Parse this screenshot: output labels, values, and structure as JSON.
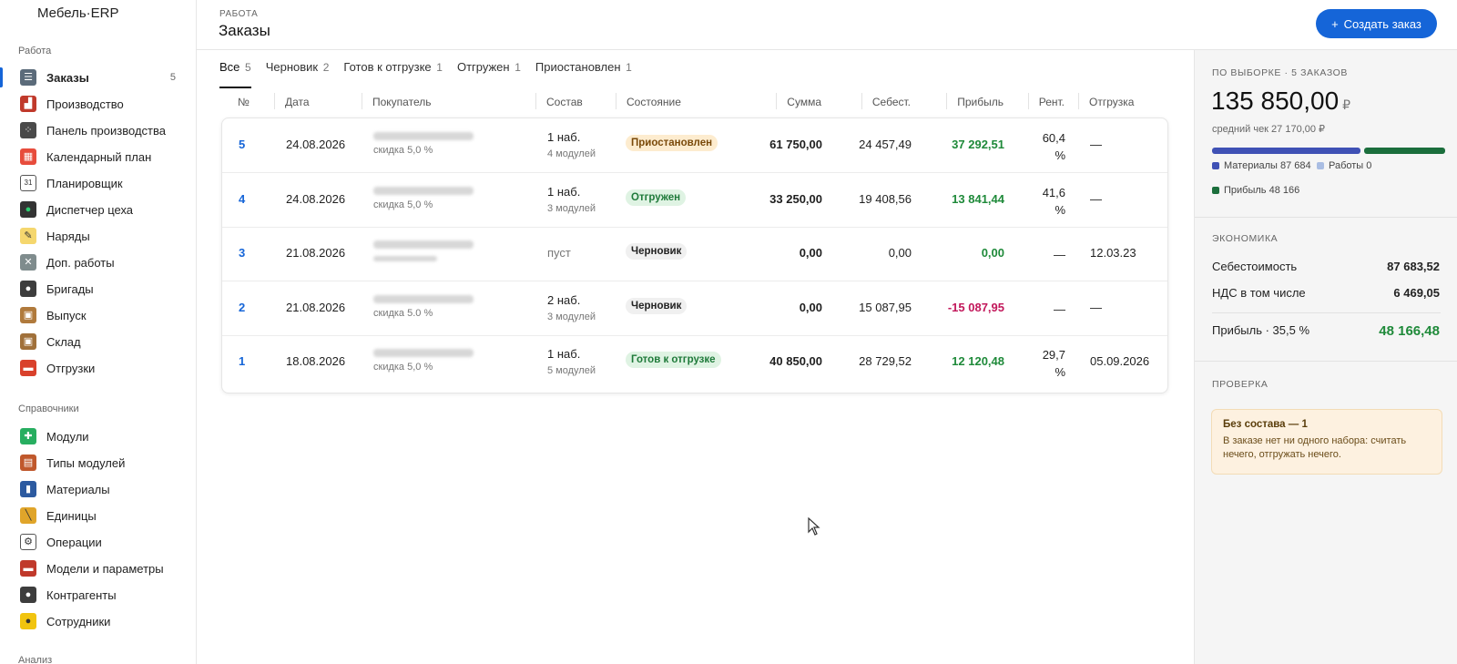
{
  "app": {
    "title": "Мебель·ERP"
  },
  "sidebar": {
    "section_work": "Работа",
    "items_work": [
      {
        "label": "Заказы",
        "icon": "clipboard-icon",
        "count": "5",
        "active": true
      },
      {
        "label": "Производство",
        "icon": "factory-icon"
      },
      {
        "label": "Панель производства",
        "icon": "dice-panel-icon"
      },
      {
        "label": "Календарный план",
        "icon": "calendar-icon"
      },
      {
        "label": "Планировщик",
        "icon": "calendar-31-icon"
      },
      {
        "label": "Диспетчер цеха",
        "icon": "traffic-light-icon"
      },
      {
        "label": "Наряды",
        "icon": "memo-icon"
      },
      {
        "label": "Доп. работы",
        "icon": "tools-icon"
      },
      {
        "label": "Бригады",
        "icon": "team-icon"
      },
      {
        "label": "Выпуск",
        "icon": "box-icon"
      },
      {
        "label": "Склад",
        "icon": "package-icon"
      },
      {
        "label": "Отгрузки",
        "icon": "truck-icon"
      }
    ],
    "section_refs": "Справочники",
    "items_refs": [
      {
        "label": "Модули",
        "icon": "puzzle-icon"
      },
      {
        "label": "Типы модулей",
        "icon": "bricks-icon"
      },
      {
        "label": "Материалы",
        "icon": "thread-icon"
      },
      {
        "label": "Единицы",
        "icon": "ruler-icon"
      },
      {
        "label": "Операции",
        "icon": "gear-icon"
      },
      {
        "label": "Модели и параметры",
        "icon": "car-icon"
      },
      {
        "label": "Контрагенты",
        "icon": "people-icon"
      },
      {
        "label": "Сотрудники",
        "icon": "worker-icon"
      }
    ],
    "section_analysis": "Анализ"
  },
  "header": {
    "breadcrumb": "РАБОТА",
    "title": "Заказы",
    "create_label": "Создать заказ",
    "create_icon": "plus-icon"
  },
  "tabs": [
    {
      "label": "Все",
      "count": "5",
      "active": true
    },
    {
      "label": "Черновик",
      "count": "2"
    },
    {
      "label": "Готов к отгрузке",
      "count": "1"
    },
    {
      "label": "Отгружен",
      "count": "1"
    },
    {
      "label": "Приостановлен",
      "count": "1"
    }
  ],
  "table": {
    "columns": [
      "№",
      "Дата",
      "Покупатель",
      "Состав",
      "Состояние",
      "Сумма",
      "Себест.",
      "Прибыль",
      "Рент.",
      "Отгрузка"
    ],
    "rows": [
      {
        "num": "5",
        "date": "24.08.2026",
        "discount": "скидка 5,0 %",
        "comp": "1 наб.",
        "comp_sub": "4 модулей",
        "status": "Приостановлен",
        "status_kind": "paused",
        "sum": "61 750,00",
        "cost": "24 457,49",
        "profit": "37 292,51",
        "profit_kind": "pos",
        "rent1": "60,4",
        "rent2": "%",
        "ship": "—"
      },
      {
        "num": "4",
        "date": "24.08.2026",
        "discount": "скидка 5,0 %",
        "comp": "1 наб.",
        "comp_sub": "3 модулей",
        "status": "Отгружен",
        "status_kind": "shipped",
        "sum": "33 250,00",
        "cost": "19 408,56",
        "profit": "13 841,44",
        "profit_kind": "pos",
        "rent1": "41,6",
        "rent2": "%",
        "ship": "—"
      },
      {
        "num": "3",
        "date": "21.08.2026",
        "discount": "",
        "comp": "пуст",
        "comp_sub": "",
        "status": "Черновик",
        "status_kind": "draft",
        "sum": "0,00",
        "cost": "0,00",
        "profit": "0,00",
        "profit_kind": "pos",
        "rent1": "—",
        "rent2": "",
        "ship": "12.03.23"
      },
      {
        "num": "2",
        "date": "21.08.2026",
        "discount": "скидка 5.0 %",
        "comp": "2 наб.",
        "comp_sub": "3 модулей",
        "status": "Черновик",
        "status_kind": "draft",
        "sum": "0,00",
        "cost": "15 087,95",
        "profit": "-15 087,95",
        "profit_kind": "neg",
        "rent1": "—",
        "rent2": "",
        "ship": "—"
      },
      {
        "num": "1",
        "date": "18.08.2026",
        "discount": "скидка 5,0 %",
        "comp": "1 наб.",
        "comp_sub": "5 модулей",
        "status": "Готов к отгрузке",
        "status_kind": "ready",
        "sum": "40 850,00",
        "cost": "28 729,52",
        "profit": "12 120,48",
        "profit_kind": "pos",
        "rent1": "29,7",
        "rent2": "%",
        "ship": "05.09.2026"
      }
    ]
  },
  "summary": {
    "section": "ПО ВЫБОРКЕ · 5 ЗАКАЗОВ",
    "total": "135 850,00",
    "currency": "₽",
    "avg_check": "средний чек 27 170,00 ₽",
    "bar_shares": {
      "materials": 87684,
      "works": 0,
      "profit": 48166
    },
    "legend": [
      {
        "label": "Материалы 87 684",
        "color": "#3f51b5"
      },
      {
        "label": "Работы 0",
        "color": "#a9bde3"
      },
      {
        "label": "Прибыль 48 166",
        "color": "#1b6e3c"
      }
    ]
  },
  "economy": {
    "section": "ЭКОНОМИКА",
    "cost_label": "Себестоимость",
    "cost_value": "87 683,52",
    "vat_label": "НДС в том числе",
    "vat_value": "6 469,05",
    "profit_label": "Прибыль · 35,5 %",
    "profit_value": "48 166,48"
  },
  "check": {
    "section": "ПРОВЕРКА",
    "alert_title": "Без состава — 1",
    "alert_text": "В заказе нет ни одного набора: считать нечего, отгружать нечего."
  }
}
